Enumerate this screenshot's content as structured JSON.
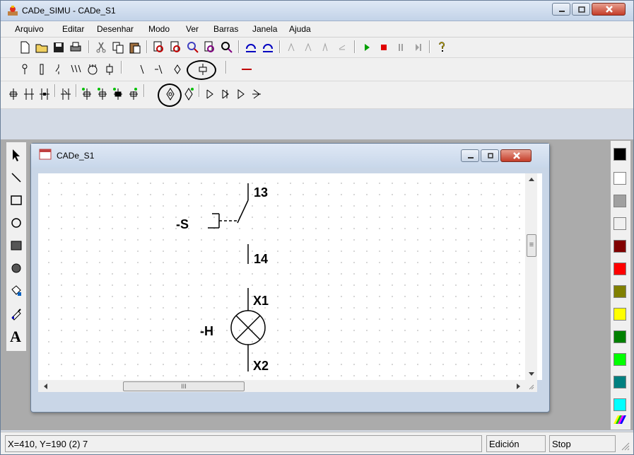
{
  "app": {
    "title": "CADe_SIMU - CADe_S1"
  },
  "menu": [
    "Arquivo",
    "Editar",
    "Desenhar",
    "Modo",
    "Ver",
    "Barras",
    "Janela",
    "Ajuda"
  ],
  "child_window": {
    "title": "CADe_S1"
  },
  "canvas": {
    "switch_label": "-S",
    "switch_top_terminal": "13",
    "switch_bottom_terminal": "14",
    "lamp_label": "-H",
    "lamp_top_terminal": "X1",
    "lamp_bottom_terminal": "X2"
  },
  "scrollbar": {
    "h_thumb_glyph": "III",
    "v_thumb_glyph": "≡"
  },
  "status": {
    "coords": "X=410, Y=190 (2) 7",
    "mode": "Edición",
    "sim_state": "Stop"
  },
  "palette": [
    "#000000",
    "#ffffff",
    "#a0a0a0",
    "#f0f0f0",
    "#800000",
    "#ff0000",
    "#808000",
    "#ffff00",
    "#008000",
    "#00ff00",
    "#008080",
    "#00ffff"
  ]
}
